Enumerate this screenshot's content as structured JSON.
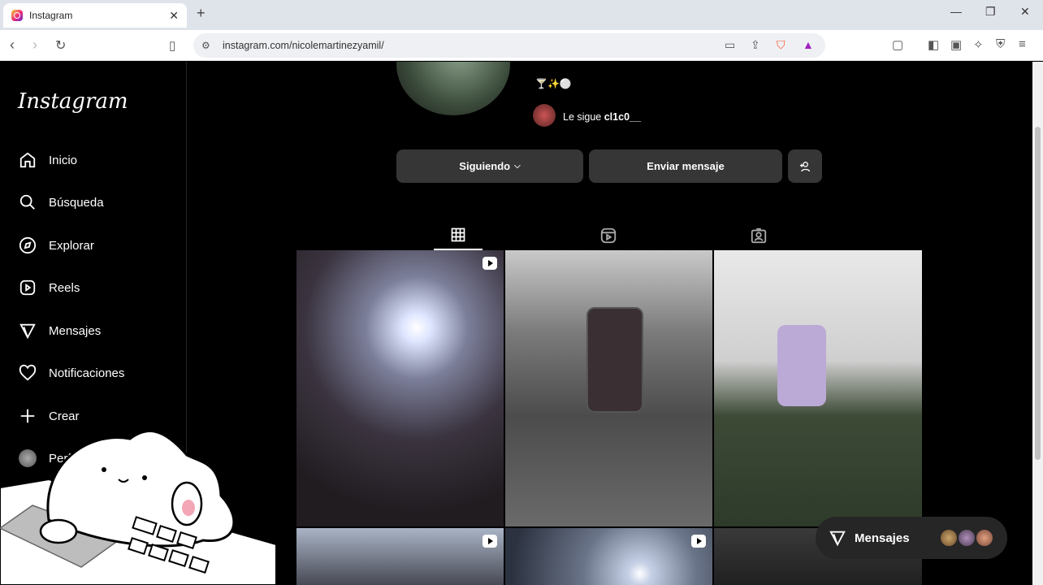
{
  "browser": {
    "tab_title": "Instagram",
    "url": "instagram.com/nicolemartinezyamil/"
  },
  "sidebar": {
    "logo": "Instagram",
    "items": [
      {
        "label": "Inicio",
        "icon": "home-icon"
      },
      {
        "label": "Búsqueda",
        "icon": "search-icon"
      },
      {
        "label": "Explorar",
        "icon": "compass-icon"
      },
      {
        "label": "Reels",
        "icon": "reels-icon"
      },
      {
        "label": "Mensajes",
        "icon": "messages-icon"
      },
      {
        "label": "Notificaciones",
        "icon": "heart-icon"
      },
      {
        "label": "Crear",
        "icon": "plus-icon"
      },
      {
        "label": "Perfil",
        "icon": "profile-avatar"
      }
    ]
  },
  "profile": {
    "bio_emojis": "🍸✨⚪",
    "followed_by_prefix": "Le sigue ",
    "followed_by_user": "cl1c0__",
    "following_button": "Siguiendo",
    "message_button": "Enviar mensaje"
  },
  "tabs": [
    {
      "name": "posts-grid-tab",
      "icon": "grid-icon",
      "active": true
    },
    {
      "name": "reels-tab",
      "icon": "reels-icon",
      "active": false
    },
    {
      "name": "tagged-tab",
      "icon": "tagged-icon",
      "active": false
    }
  ],
  "floating": {
    "messages_label": "Mensajes"
  },
  "colors": {
    "background": "#000000",
    "button": "#363636",
    "pill": "#262626"
  }
}
